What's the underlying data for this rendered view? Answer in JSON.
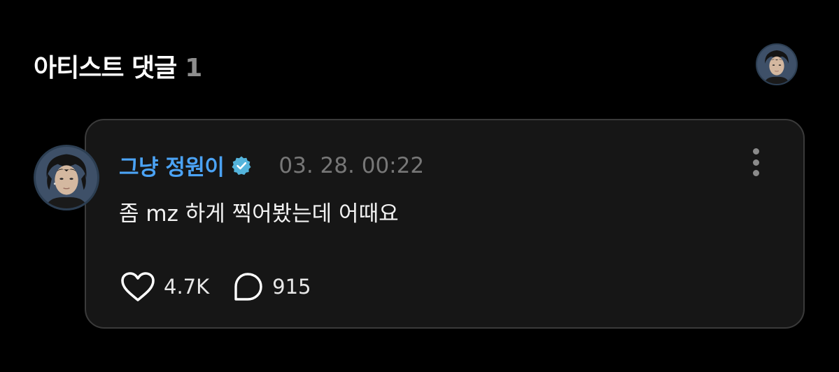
{
  "header": {
    "title": "아티스트 댓글",
    "count": "1",
    "avatar_icon": "profile-avatar"
  },
  "comment": {
    "author": "그냥 정원이",
    "verified": true,
    "timestamp": "03. 28. 00:22",
    "text": "좀 mz 하게 찍어봤는데 어때요",
    "likes": "4.7K",
    "replies": "915",
    "icons": {
      "like": "heart-icon",
      "reply": "speech-bubble-icon",
      "more": "vertical-dots-icon",
      "verified": "verified-check-icon"
    }
  },
  "colors": {
    "background": "#000000",
    "card": "#161616",
    "author": "#4ba3f5",
    "timestamp": "#777777",
    "count": "#8e8e8e"
  }
}
